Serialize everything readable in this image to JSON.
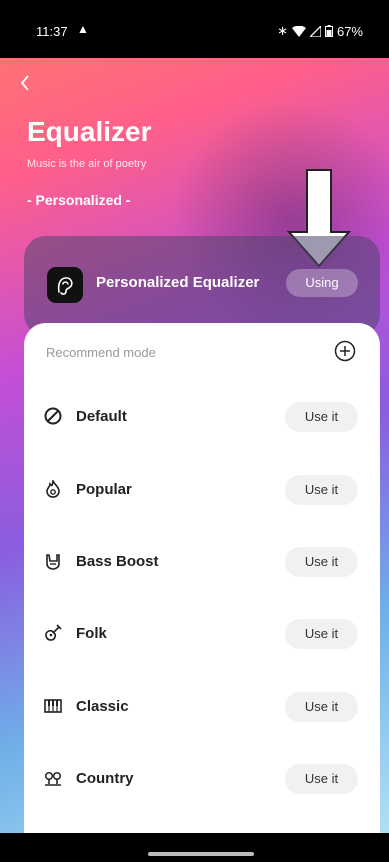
{
  "status": {
    "time": "11:37",
    "battery": "67%"
  },
  "header": {
    "title": "Equalizer",
    "subtitle": "Music is the air of poetry",
    "section": "- Personalized -"
  },
  "personalized": {
    "label": "Personalized Equalizer",
    "button": "Using"
  },
  "recommend": {
    "label": "Recommend mode",
    "items": [
      {
        "name": "Default",
        "icon": "prohibited-icon",
        "button": "Use it"
      },
      {
        "name": "Popular",
        "icon": "flame-icon",
        "button": "Use it"
      },
      {
        "name": "Bass Boost",
        "icon": "rock-hand-icon",
        "button": "Use it"
      },
      {
        "name": "Folk",
        "icon": "guitar-icon",
        "button": "Use it"
      },
      {
        "name": "Classic",
        "icon": "piano-icon",
        "button": "Use it"
      },
      {
        "name": "Country",
        "icon": "banjo-icon",
        "button": "Use it"
      }
    ]
  },
  "colors": {
    "accent": "#c34fd6",
    "card": "#ffffff"
  }
}
